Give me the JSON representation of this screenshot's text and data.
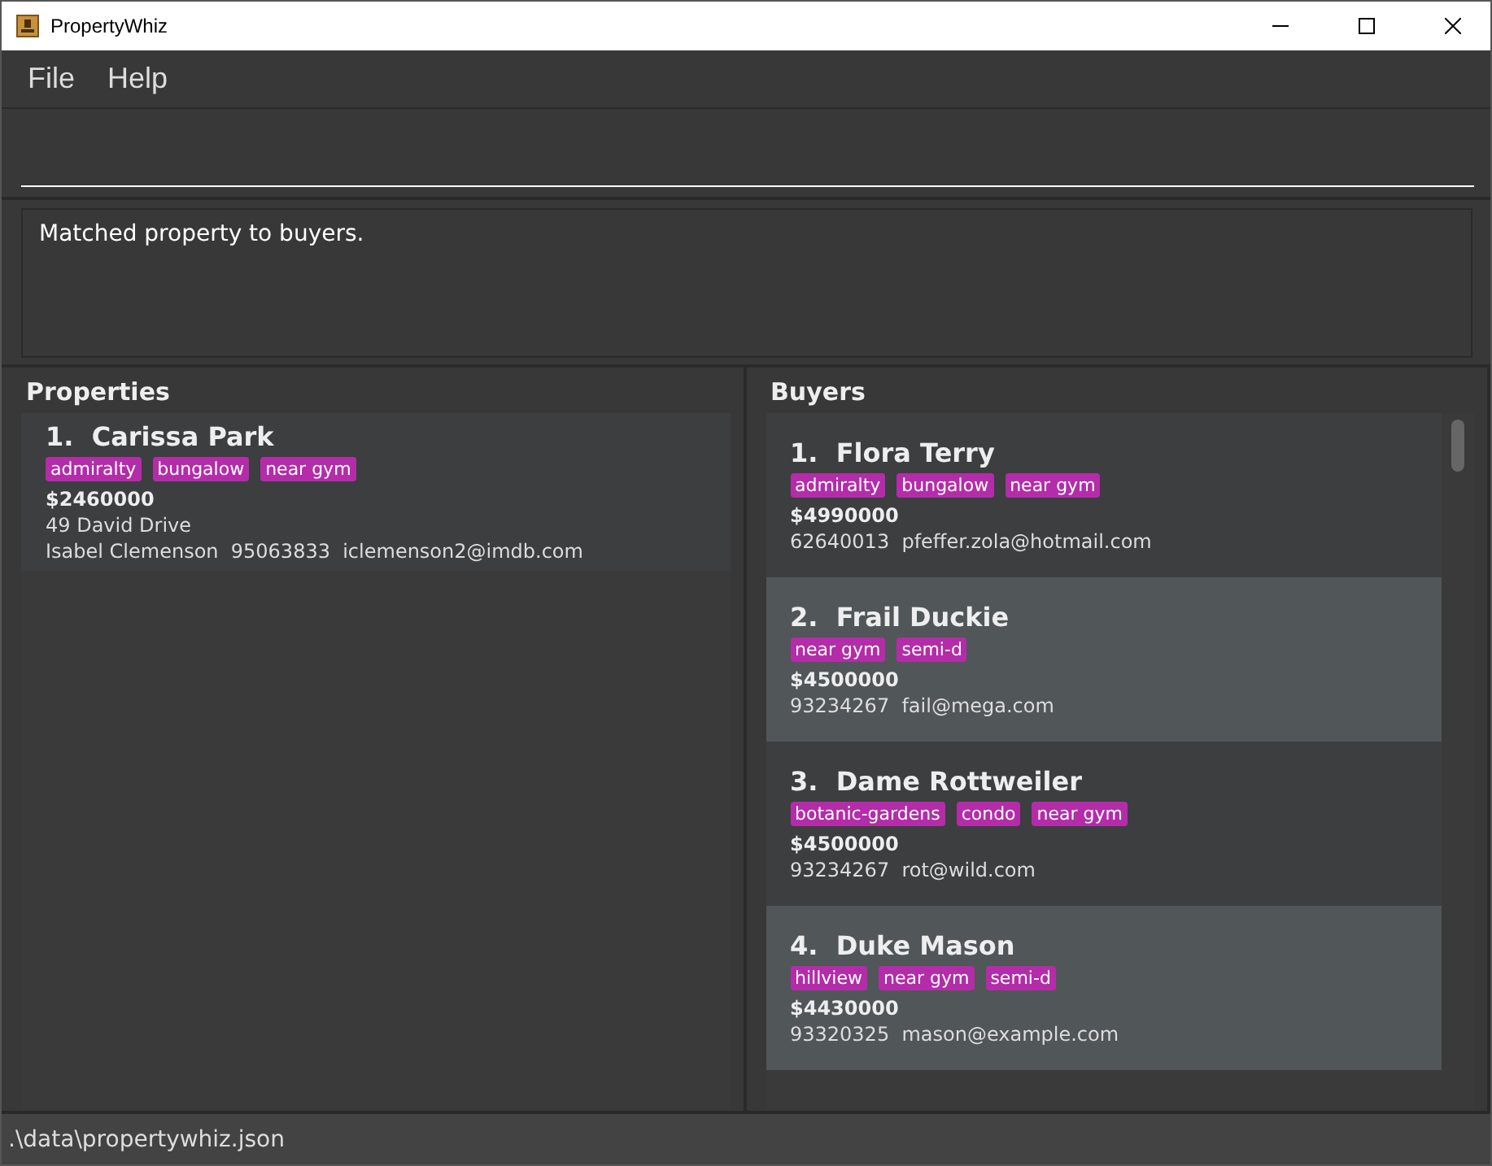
{
  "window": {
    "title": "PropertyWhiz"
  },
  "menu": [
    "File",
    "Help"
  ],
  "result": "Matched property to buyers.",
  "properties": {
    "title": "Properties",
    "items": [
      {
        "index": "1.",
        "name": "Carissa Park",
        "tags": [
          "admiralty",
          "bungalow",
          "near gym"
        ],
        "price": "$2460000",
        "address": "49 David Drive",
        "seller": "Isabel Clemenson",
        "phone": "95063833",
        "email": "iclemenson2@imdb.com"
      }
    ]
  },
  "buyers": {
    "title": "Buyers",
    "items": [
      {
        "index": "1.",
        "name": "Flora Terry",
        "tags": [
          "admiralty",
          "bungalow",
          "near gym"
        ],
        "price": "$4990000",
        "phone": "62640013",
        "email": "pfeffer.zola@hotmail.com"
      },
      {
        "index": "2.",
        "name": "Frail Duckie",
        "tags": [
          "near gym",
          "semi-d"
        ],
        "price": "$4500000",
        "phone": "93234267",
        "email": "fail@mega.com"
      },
      {
        "index": "3.",
        "name": "Dame Rottweiler",
        "tags": [
          "botanic-gardens",
          "condo",
          "near gym"
        ],
        "price": "$4500000",
        "phone": "93234267",
        "email": "rot@wild.com"
      },
      {
        "index": "4.",
        "name": "Duke Mason",
        "tags": [
          "hillview",
          "near gym",
          "semi-d"
        ],
        "price": "$4430000",
        "phone": "93320325",
        "email": "mason@example.com"
      }
    ]
  },
  "status_bar": ".\\data\\propertywhiz.json"
}
